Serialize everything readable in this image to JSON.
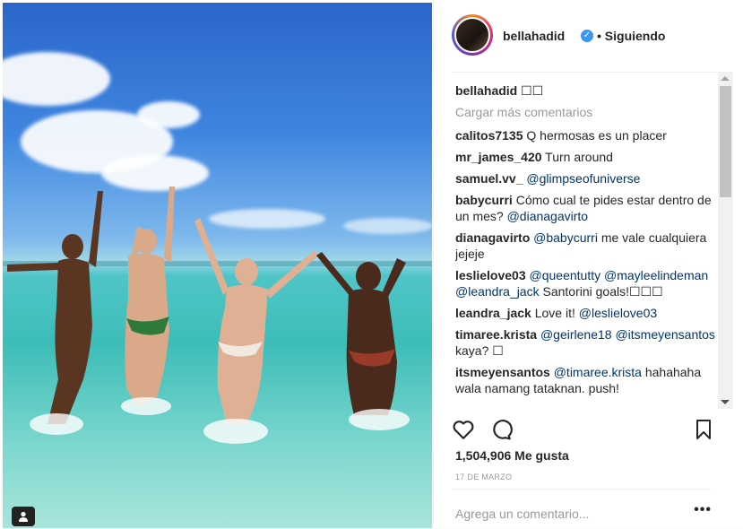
{
  "post": {
    "username": "bellahadid",
    "follow_status": "Siguiendo",
    "caption_user": "bellahadid",
    "caption_text": "☐☐",
    "load_more": "Cargar más comentarios",
    "comments": [
      {
        "user": "calitos7135",
        "parts": [
          {
            "t": "Q hermosas es un placer"
          }
        ]
      },
      {
        "user": "mr_james_420",
        "parts": [
          {
            "t": "Turn around"
          }
        ]
      },
      {
        "user": "samuel.vv_",
        "parts": [
          {
            "t": "@glimpseofuniverse",
            "m": true
          }
        ]
      },
      {
        "user": "babycurri",
        "parts": [
          {
            "t": "Cómo cual te pides estar dentro de un mes? "
          },
          {
            "t": "@dianagavirto",
            "m": true
          }
        ]
      },
      {
        "user": "dianagavirto",
        "parts": [
          {
            "t": "@babycurri",
            "m": true
          },
          {
            "t": " me vale cualquiera jejeje"
          }
        ]
      },
      {
        "user": "leslielove03",
        "parts": [
          {
            "t": "@queentutty",
            "m": true
          },
          {
            "t": " "
          },
          {
            "t": "@mayleelindeman",
            "m": true
          },
          {
            "t": " "
          },
          {
            "t": "@leandra_jack",
            "m": true
          },
          {
            "t": " Santorini goals!☐☐☐"
          }
        ]
      },
      {
        "user": "leandra_jack",
        "parts": [
          {
            "t": "Love it! "
          },
          {
            "t": "@leslielove03",
            "m": true
          }
        ]
      },
      {
        "user": "timaree.krista",
        "parts": [
          {
            "t": "@geirlene18",
            "m": true
          },
          {
            "t": " "
          },
          {
            "t": "@itsmeyensantos",
            "m": true
          },
          {
            "t": " kaya? ☐"
          }
        ]
      },
      {
        "user": "itsmeyensantos",
        "parts": [
          {
            "t": "@timaree.krista",
            "m": true
          },
          {
            "t": " hahahaha wala namang tataknan. push!"
          }
        ]
      }
    ],
    "likes": "1,504,906 Me gusta",
    "date": "17 DE MARZO",
    "comment_placeholder": "Agrega un comentario...",
    "more_options": "•••",
    "icons": [
      "heart-icon",
      "comment-icon",
      "bookmark-icon",
      "verified-icon",
      "user-tag-icon"
    ]
  }
}
